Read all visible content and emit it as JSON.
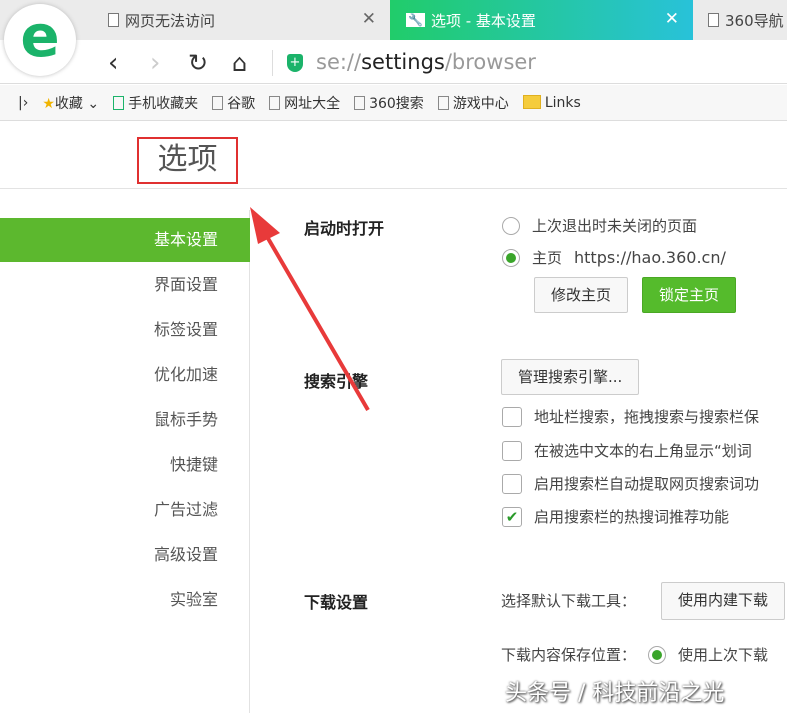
{
  "tabs": [
    {
      "label": "网页无法访问"
    },
    {
      "label": "选项 - 基本设置"
    },
    {
      "label": "360导航"
    }
  ],
  "logo_letter": "e",
  "address": {
    "prefix": "se://",
    "bold": "settings",
    "suffix": "/browser"
  },
  "bookmarks": [
    "收藏",
    "手机收藏夹",
    "谷歌",
    "网址大全",
    "360搜索",
    "游戏中心",
    "Links"
  ],
  "page_title": "选项",
  "sidebar": [
    "基本设置",
    "界面设置",
    "标签设置",
    "优化加速",
    "鼠标手势",
    "快捷键",
    "广告过滤",
    "高级设置",
    "实验室"
  ],
  "startup": {
    "label": "启动时打开",
    "opt1": "上次退出时未关闭的页面",
    "opt2": "主页",
    "homepage_url": "https://hao.360.cn/",
    "modify_btn": "修改主页",
    "lock_btn": "锁定主页"
  },
  "search": {
    "label": "搜索引擎",
    "manage_btn": "管理搜索引擎...",
    "checks": [
      {
        "label": "地址栏搜索，拖拽搜索与搜索栏保",
        "checked": false
      },
      {
        "label": "在被选中文本的右上角显示“划词",
        "checked": false
      },
      {
        "label": "启用搜索栏自动提取网页搜索词功",
        "checked": false
      },
      {
        "label": "启用搜索栏的热搜词推荐功能",
        "checked": true
      }
    ]
  },
  "download": {
    "label": "下载设置",
    "tool_label": "选择默认下载工具：",
    "tool_value": "使用内建下载",
    "location_label": "下载内容保存位置：",
    "location_opt": "使用上次下载"
  },
  "watermark": "头条号 / 科技前沿之光",
  "colors": {
    "accent": "#5cb82e",
    "annotation": "#e03030"
  }
}
